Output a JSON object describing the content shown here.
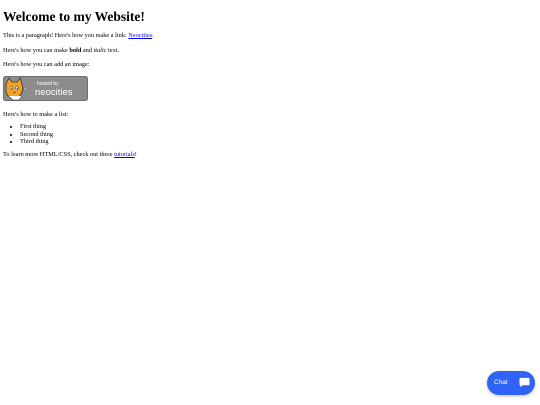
{
  "page": {
    "heading": "Welcome to my Website!",
    "para1_text": "This is a paragraph! Here's how you make a link: ",
    "para1_link": "Neocities",
    "para1_end": ".",
    "para2_start": "Here's how you can make ",
    "para2_bold": "bold",
    "para2_mid": " and ",
    "para2_italic": "italic",
    "para2_end": " text.",
    "para3": "Here's how you can add an image:",
    "badge_small": "hosted by",
    "badge_big": "neocities",
    "para4": "Here's how to make a list:",
    "list": [
      "First thing",
      "Second thing",
      "Third thing"
    ],
    "para5_start": "To learn more HTML/CSS, check out these ",
    "para5_link": "tutorials",
    "para5_end": "!"
  },
  "chat": {
    "label": "Chat",
    "icon": "chat-bubble-icon",
    "color": "#2f63f5"
  }
}
